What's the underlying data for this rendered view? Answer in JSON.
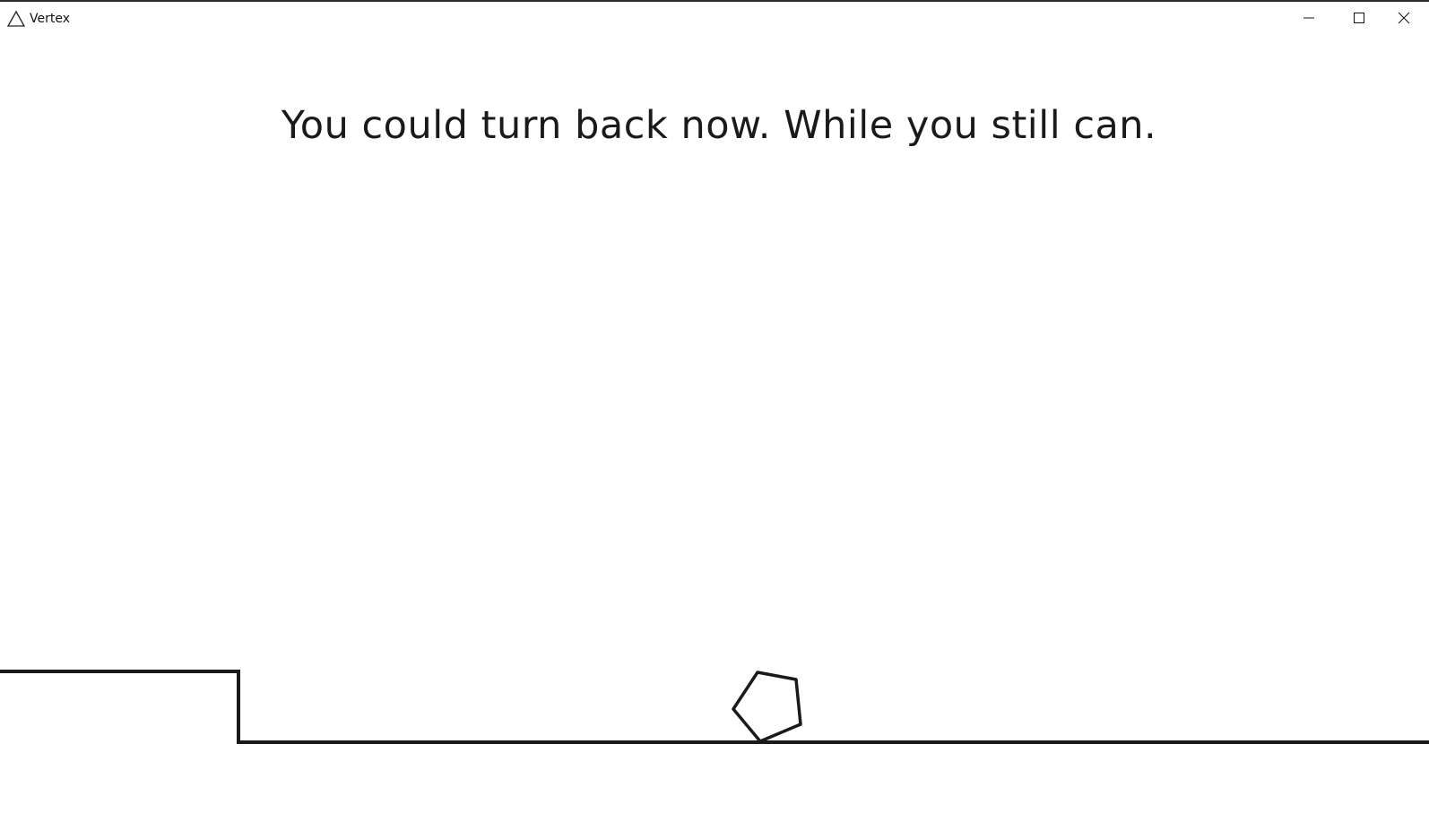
{
  "window": {
    "title": "Vertex",
    "icon": "triangle-outline-icon",
    "controls": {
      "minimize_icon": "minimize-icon",
      "maximize_icon": "maximize-icon",
      "close_icon": "close-icon"
    }
  },
  "game": {
    "message": "You could turn back now. While you still can.",
    "player_shape": "pentagon",
    "colors": {
      "background": "#ffffff",
      "ink": "#1a1a1a"
    }
  }
}
